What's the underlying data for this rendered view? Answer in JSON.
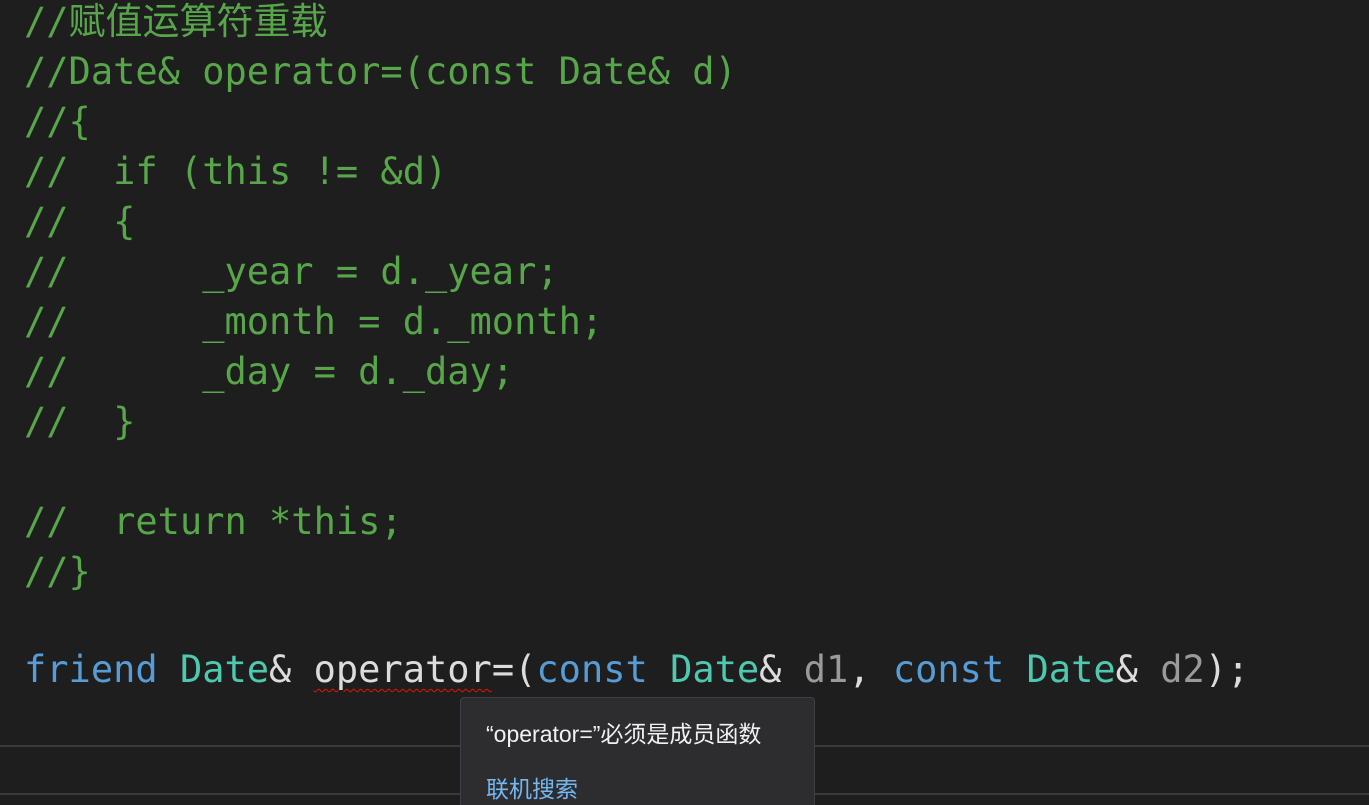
{
  "code": {
    "comment_lines": [
      "//赋值运算符重载",
      "//Date& operator=(const Date& d)",
      "//{",
      "//  if (this != &d)",
      "//  {",
      "//      _year = d._year;",
      "//      _month = d._month;",
      "//      _day = d._day;",
      "//  }",
      "",
      "//  return *this;",
      "//}"
    ],
    "declaration": {
      "kw_friend": "friend",
      "type_date_1": "Date",
      "amp_1": "& ",
      "func_name": "operator",
      "op_eq_paren": "=(",
      "kw_const_1": "const",
      "type_date_2": "Date",
      "amp_2": "& ",
      "param_1": "d1",
      "comma": ", ",
      "kw_const_2": "const",
      "type_date_3": "Date",
      "amp_3": "& ",
      "param_2": "d2",
      "close": ");"
    }
  },
  "tooltip": {
    "message": "“operator=”必须是成员函数",
    "link": "联机搜索"
  },
  "colors": {
    "background": "#1e1e1e",
    "comment": "#57a64a",
    "keyword": "#569cd6",
    "type": "#4ec9b0",
    "parameter": "#9a9a9a",
    "error_squiggle": "#e51400",
    "tooltip_bg": "#2d2d30",
    "link": "#75b7f0"
  }
}
